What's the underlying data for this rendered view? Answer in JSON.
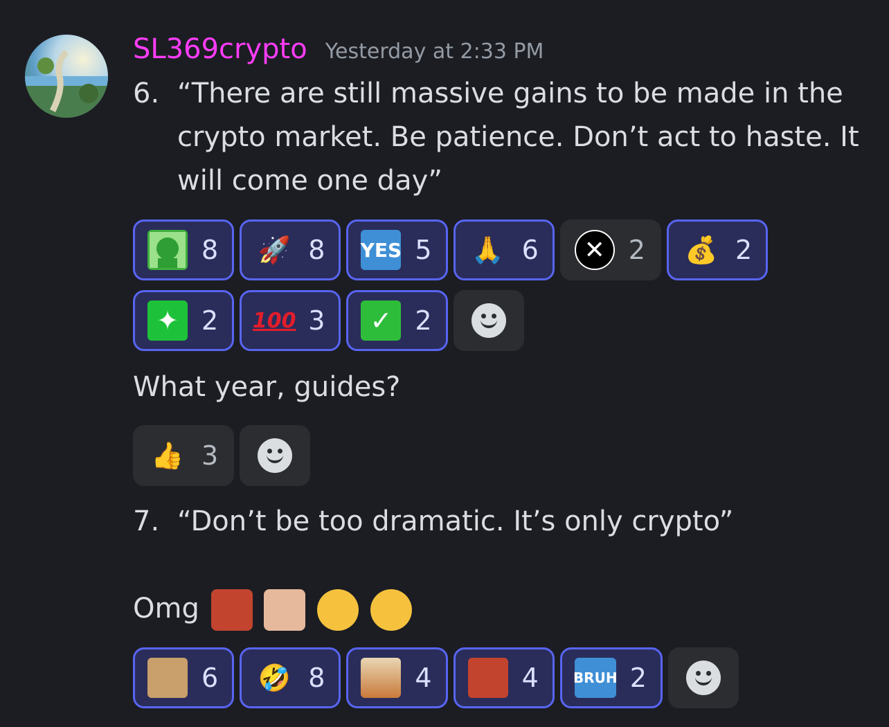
{
  "message": {
    "username": "SL369crypto",
    "timestamp": "Yesterday at 2:33 PM",
    "item6_num": "6.",
    "item6_text": "“There are still massive gains to be made in the crypto market. Be patience. Don’t act to haste. It will come one day”",
    "reactions1": [
      {
        "emoji_name": "pepe-icon",
        "count": "8",
        "selected": true
      },
      {
        "emoji_name": "rocket-icon",
        "count": "8",
        "selected": true
      },
      {
        "emoji_name": "yes-icon",
        "count": "5",
        "selected": true
      },
      {
        "emoji_name": "praying-hands-icon",
        "count": "6",
        "selected": true
      },
      {
        "emoji_name": "xrp-icon",
        "count": "2",
        "selected": false
      },
      {
        "emoji_name": "money-bag-icon",
        "count": "2",
        "selected": true
      },
      {
        "emoji_name": "sparkle-icon",
        "count": "2",
        "selected": true
      },
      {
        "emoji_name": "hundred-icon",
        "count": "3",
        "selected": true
      },
      {
        "emoji_name": "check-mark-icon",
        "count": "2",
        "selected": true
      }
    ],
    "question": "What year, guides?",
    "reactions2": [
      {
        "emoji_name": "thumbs-up-icon",
        "count": "3",
        "selected": false
      }
    ],
    "item7_num": "7.",
    "item7_text": "“Don’t be too dramatic. It’s only crypto”",
    "omg_text": "Omg",
    "reactions3": [
      {
        "emoji_name": "laughing-dog-icon",
        "count": "6",
        "selected": true
      },
      {
        "emoji_name": "rofl-icon",
        "count": "8",
        "selected": true
      },
      {
        "emoji_name": "explosion-icon",
        "count": "4",
        "selected": true
      },
      {
        "emoji_name": "crying-man-icon",
        "count": "4",
        "selected": true
      },
      {
        "emoji_name": "bruh-icon",
        "count": "2",
        "selected": true
      }
    ]
  }
}
